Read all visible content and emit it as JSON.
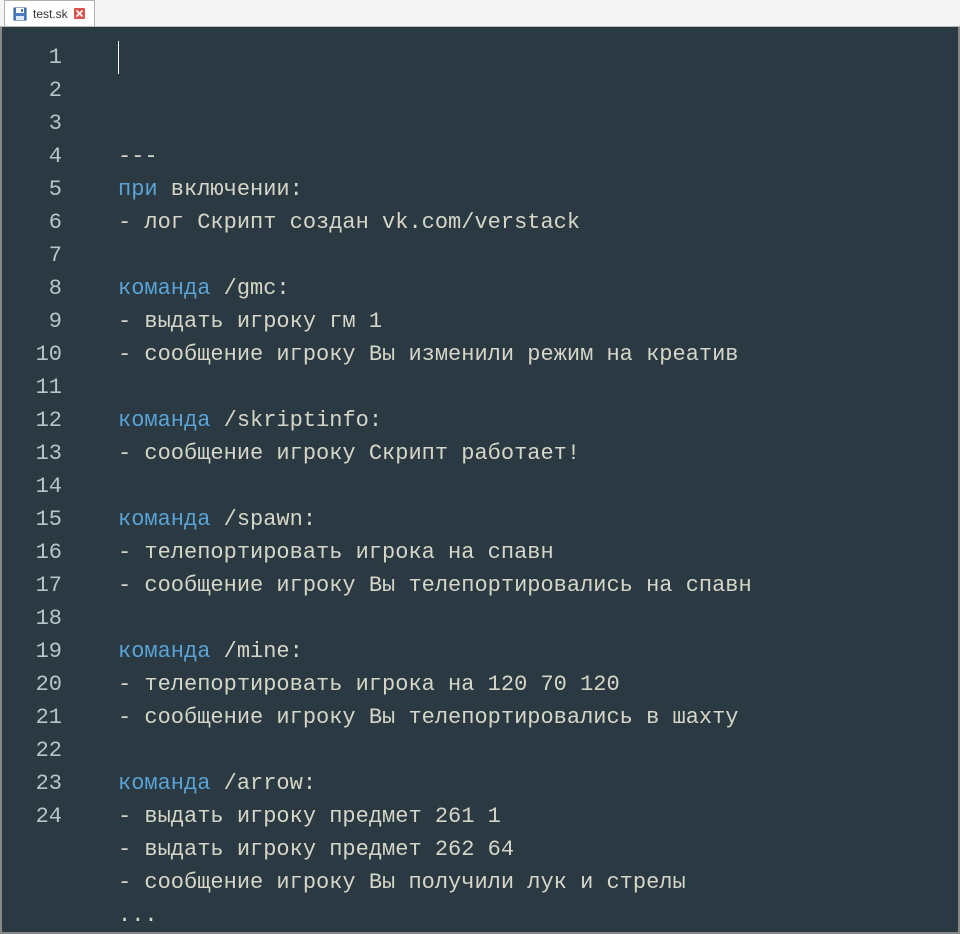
{
  "tab": {
    "filename": "test.sk"
  },
  "editor": {
    "lines": [
      {
        "n": 1,
        "segments": [
          {
            "cls": "comment",
            "t": "---"
          }
        ]
      },
      {
        "n": 2,
        "segments": [
          {
            "cls": "kw",
            "t": "при"
          },
          {
            "cls": "rest",
            "t": " включении:"
          }
        ]
      },
      {
        "n": 3,
        "segments": [
          {
            "cls": "rest",
            "t": "- лог Скрипт создан vk.com/verstack"
          }
        ]
      },
      {
        "n": 4,
        "segments": []
      },
      {
        "n": 5,
        "segments": [
          {
            "cls": "kw",
            "t": "команда"
          },
          {
            "cls": "rest",
            "t": " /gmc:"
          }
        ]
      },
      {
        "n": 6,
        "segments": [
          {
            "cls": "rest",
            "t": "- выдать игроку гм 1"
          }
        ]
      },
      {
        "n": 7,
        "segments": [
          {
            "cls": "rest",
            "t": "- сообщение игроку Вы изменили режим на креатив"
          }
        ]
      },
      {
        "n": 8,
        "segments": []
      },
      {
        "n": 9,
        "segments": [
          {
            "cls": "kw",
            "t": "команда"
          },
          {
            "cls": "rest",
            "t": " /skriptinfo:"
          }
        ]
      },
      {
        "n": 10,
        "segments": [
          {
            "cls": "rest",
            "t": "- сообщение игроку Скрипт работает!"
          }
        ]
      },
      {
        "n": 11,
        "segments": []
      },
      {
        "n": 12,
        "segments": [
          {
            "cls": "kw",
            "t": "команда"
          },
          {
            "cls": "rest",
            "t": " /spawn:"
          }
        ]
      },
      {
        "n": 13,
        "segments": [
          {
            "cls": "rest",
            "t": "- телепортировать игрока на спавн"
          }
        ]
      },
      {
        "n": 14,
        "segments": [
          {
            "cls": "rest",
            "t": "- сообщение игроку Вы телепортировались на спавн"
          }
        ]
      },
      {
        "n": 15,
        "segments": []
      },
      {
        "n": 16,
        "segments": [
          {
            "cls": "kw",
            "t": "команда"
          },
          {
            "cls": "rest",
            "t": " /mine:"
          }
        ]
      },
      {
        "n": 17,
        "segments": [
          {
            "cls": "rest",
            "t": "- телепортировать игрока на 120 70 120"
          }
        ]
      },
      {
        "n": 18,
        "segments": [
          {
            "cls": "rest",
            "t": "- сообщение игроку Вы телепортировались в шахту"
          }
        ]
      },
      {
        "n": 19,
        "segments": []
      },
      {
        "n": 20,
        "segments": [
          {
            "cls": "kw",
            "t": "команда"
          },
          {
            "cls": "rest",
            "t": " /arrow:"
          }
        ]
      },
      {
        "n": 21,
        "segments": [
          {
            "cls": "rest",
            "t": "- выдать игроку предмет 261 1"
          }
        ]
      },
      {
        "n": 22,
        "segments": [
          {
            "cls": "rest",
            "t": "- выдать игроку предмет 262 64"
          }
        ]
      },
      {
        "n": 23,
        "segments": [
          {
            "cls": "rest",
            "t": "- сообщение игроку Вы получили лук и стрелы"
          }
        ]
      },
      {
        "n": 24,
        "segments": [
          {
            "cls": "rest",
            "t": "..."
          }
        ]
      }
    ]
  }
}
